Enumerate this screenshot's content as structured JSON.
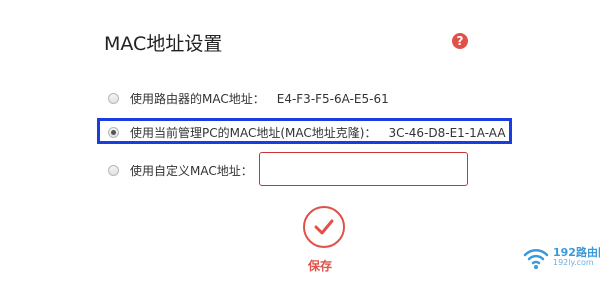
{
  "title": "MAC地址设置",
  "help_icon": "question-mark-icon",
  "options": [
    {
      "label": "使用路由器的MAC地址：",
      "value": "E4-F3-F5-6A-E5-61",
      "checked": false
    },
    {
      "label": "使用当前管理PC的MAC地址(MAC地址克隆)：",
      "value": "3C-46-D8-E1-1A-AA",
      "checked": true
    },
    {
      "label": "使用自定义MAC地址：",
      "value": "",
      "checked": false
    }
  ],
  "custom_input": {
    "value": "",
    "placeholder": ""
  },
  "save": {
    "label": "保存",
    "icon": "checkmark-icon"
  },
  "watermark": {
    "title": "192路由网",
    "subtitle": "192ly.com",
    "icon": "wifi-icon"
  },
  "colors": {
    "accent": "#e0514a",
    "highlight_border": "#1a3de0",
    "input_border": "#c9343a",
    "watermark": "#3a9ad9"
  }
}
